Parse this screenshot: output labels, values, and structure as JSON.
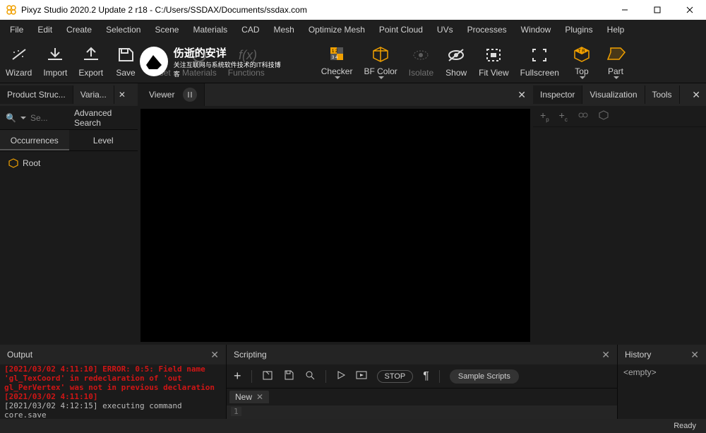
{
  "window": {
    "title": "Pixyz Studio 2020.2 Update 2 r18 - C:/Users/SSDAX/Documents/ssdax.com"
  },
  "menu": [
    "File",
    "Edit",
    "Create",
    "Selection",
    "Scene",
    "Materials",
    "CAD",
    "Mesh",
    "Optimize Mesh",
    "Point Cloud",
    "UVs",
    "Processes",
    "Window",
    "Plugins",
    "Help"
  ],
  "ribbon": {
    "wizard": "Wizard",
    "import": "Import",
    "export": "Export",
    "save": "Save",
    "reset": "Reset",
    "materials": "Materials",
    "functions": "Functions",
    "checker": "Checker",
    "bfcolor": "BF Color",
    "isolate": "Isolate",
    "show": "Show",
    "fitview": "Fit View",
    "fullscreen": "Fullscreen",
    "top": "Top",
    "part": "Part"
  },
  "leftTabs": {
    "product": "Product Struc...",
    "variants": "Varia..."
  },
  "viewerTab": "Viewer",
  "search": {
    "placeholder": "Se...",
    "advanced": "Advanced Search"
  },
  "subTabs": {
    "occurrences": "Occurrences",
    "level": "Level"
  },
  "treeRoot": "Root",
  "rightTabs": {
    "inspector": "Inspector",
    "visualization": "Visualization",
    "tools": "Tools"
  },
  "bottom": {
    "output": "Output",
    "scripting": "Scripting",
    "history": "History",
    "historyEmpty": "<empty>",
    "stop": "STOP",
    "sample": "Sample Scripts",
    "newTab": "New",
    "lineNo": "1"
  },
  "log": {
    "l1": "[2021/03/02 4:11:10] ERROR: 0:5: Field name",
    "l2": "'gl_TexCoord' in redeclaration of 'out",
    "l3": "gl_PerVertex' was not in previous declaration",
    "l4": "[2021/03/02 4:11:10]",
    "l5": "[2021/03/02 4:12:15] executing command",
    "l6": "core.save"
  },
  "status": "Ready",
  "wm": {
    "line1": "伤逝的安详",
    "line2": "关注互联网与系统软件技术的IT科技博客"
  }
}
